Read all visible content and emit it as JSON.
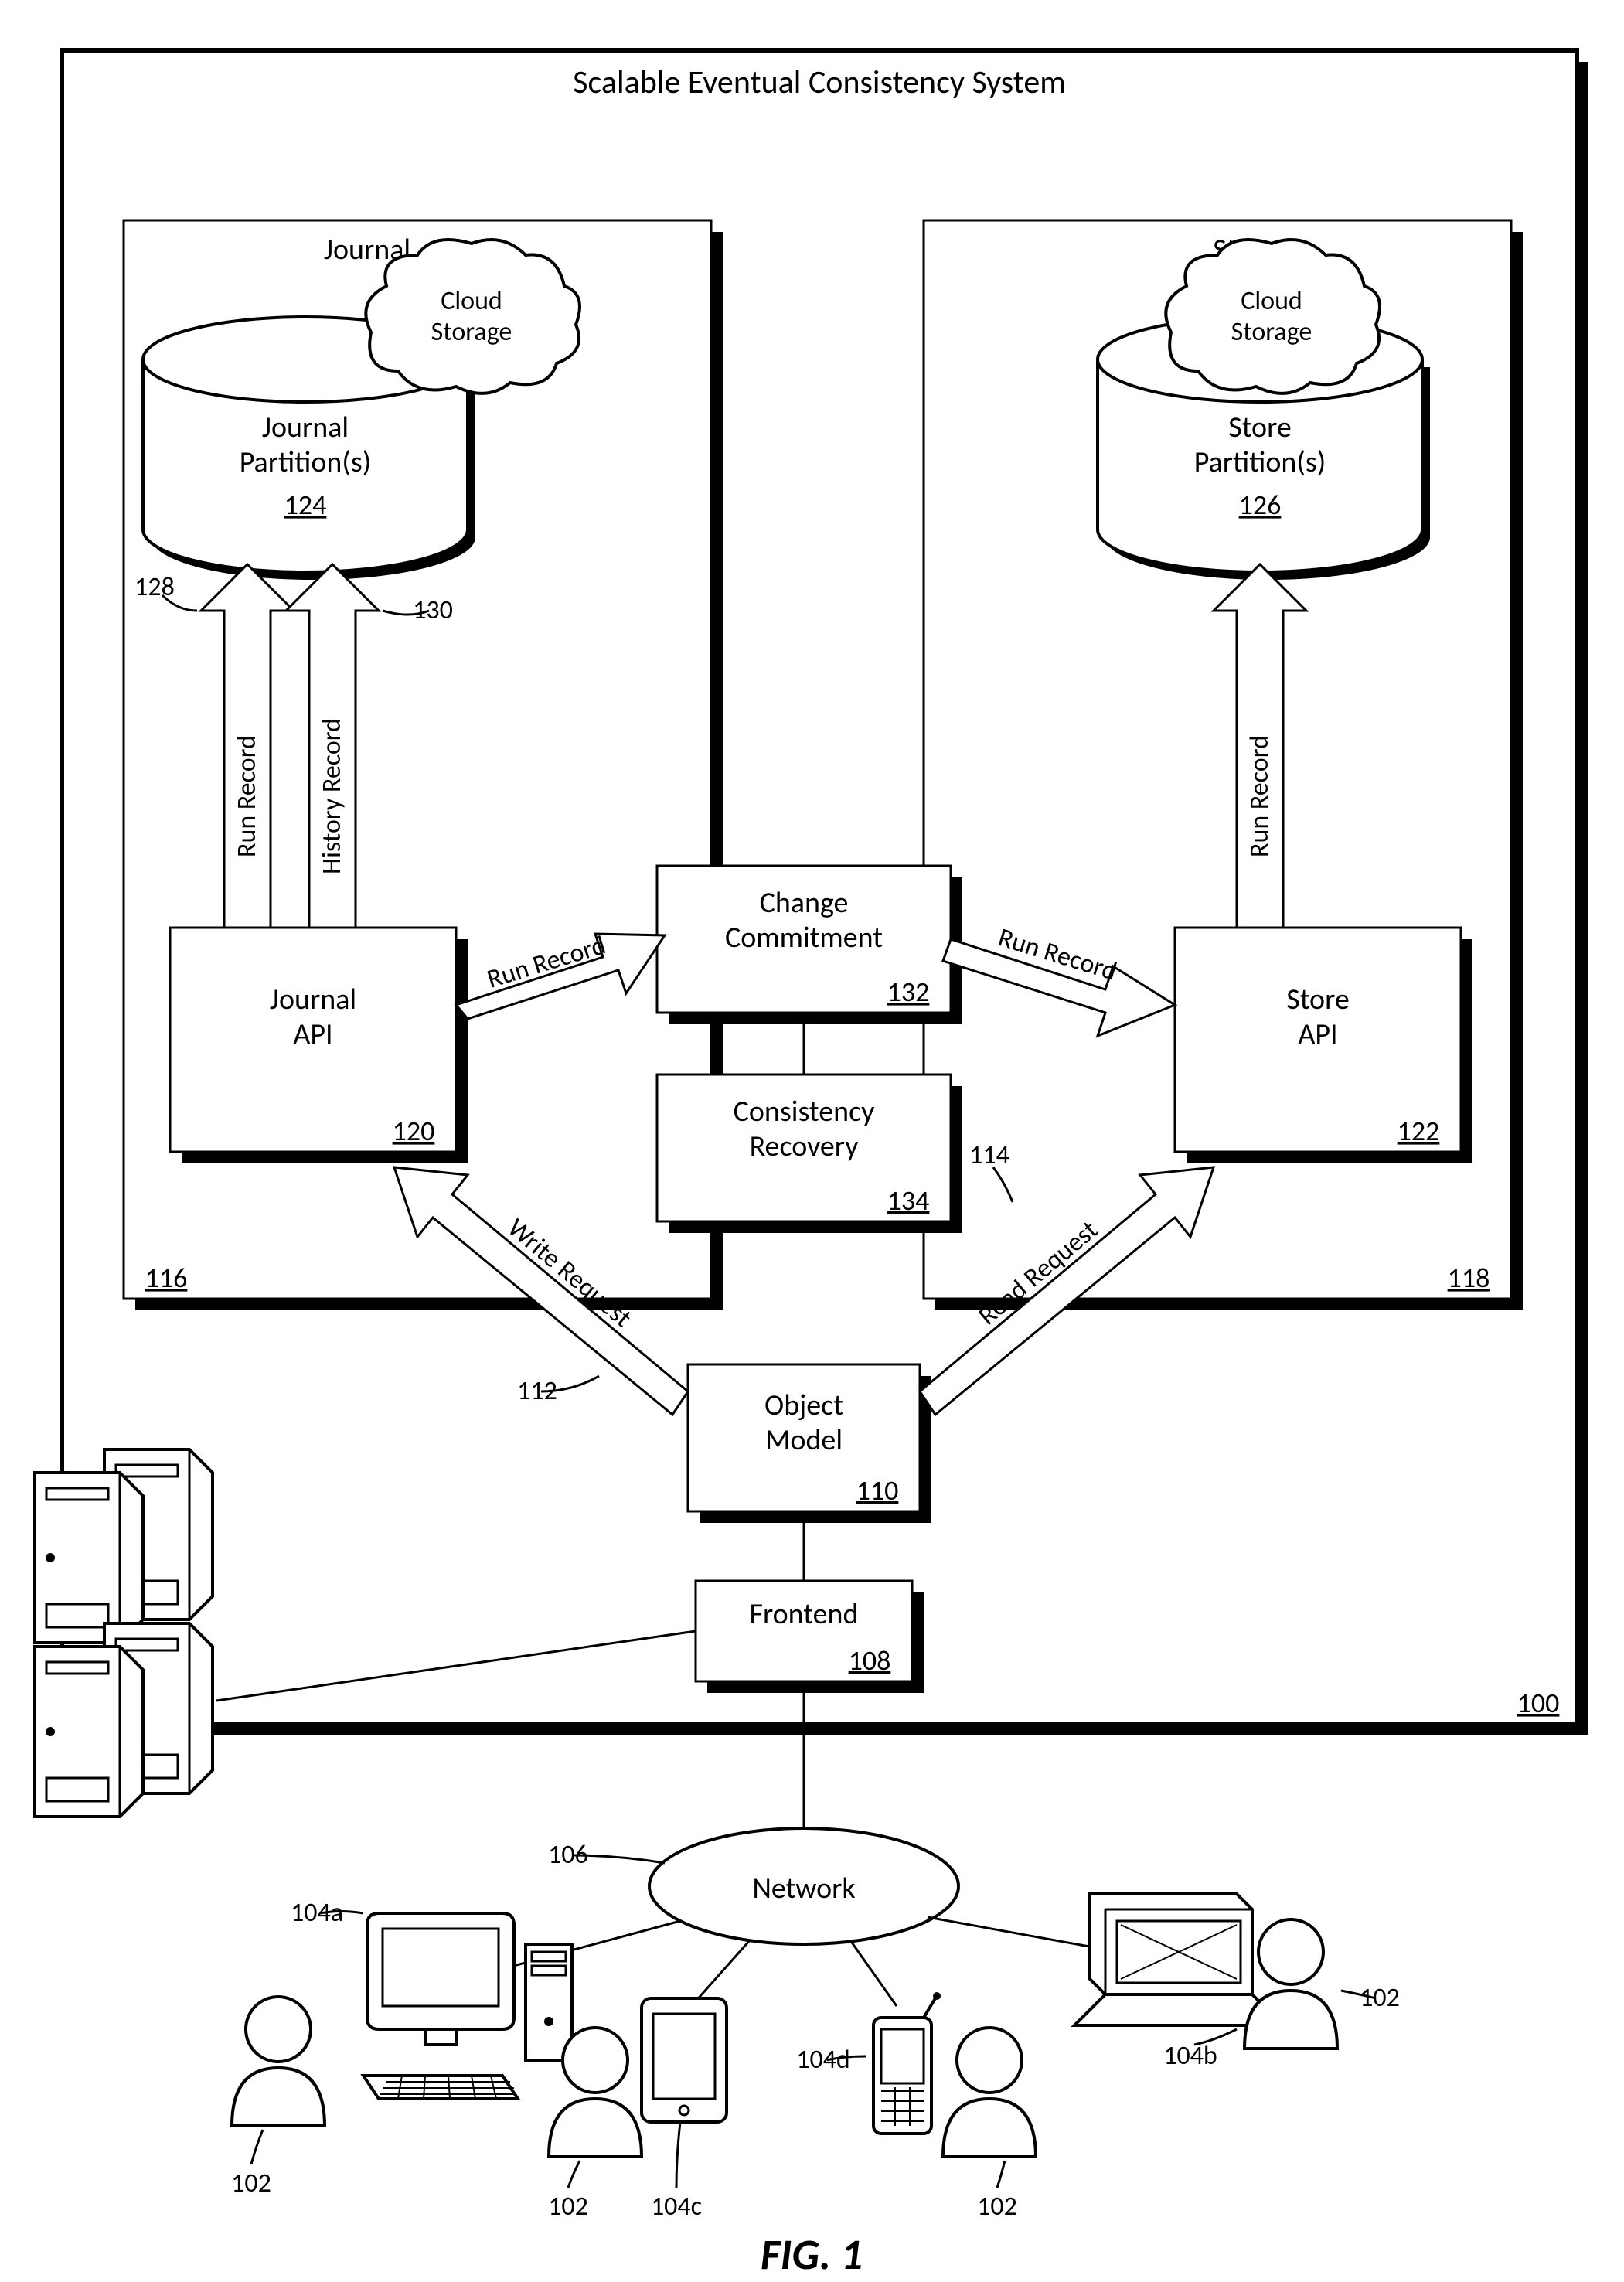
{
  "title": "Scalable Eventual Consistency System",
  "journal": {
    "heading": "Journal",
    "cloud": "Cloud Storage",
    "partitions": "Journal Partition(s)",
    "partitions_ref": "124",
    "api": "Journal API",
    "api_ref": "120",
    "box_ref": "116",
    "arrow_left": "Run Record",
    "arrow_right": "History Record",
    "ref_128": "128",
    "ref_130": "130"
  },
  "store": {
    "heading": "Store",
    "cloud": "Cloud Storage",
    "partitions": "Store Partition(s)",
    "partitions_ref": "126",
    "api": "Store API",
    "api_ref": "122",
    "box_ref": "118",
    "arrow": "Run Record"
  },
  "center": {
    "change_commitment": "Change Commitment",
    "change_commitment_ref": "132",
    "consistency_recovery": "Consistency Recovery",
    "consistency_recovery_ref": "134",
    "run_record_left": "Run Record",
    "run_record_right": "Run Record"
  },
  "object_model": {
    "label": "Object Model",
    "ref": "110",
    "write": "Write Request",
    "read": "Read Request",
    "ref_112": "112",
    "ref_114": "114"
  },
  "frontend": {
    "label": "Frontend",
    "ref": "108"
  },
  "system_ref": "100",
  "network": {
    "label": "Network",
    "ref_106": "106",
    "ref_104a": "104a",
    "ref_104b": "104b",
    "ref_104c": "104c",
    "ref_104d": "104d",
    "ref_102": "102"
  },
  "fig": "FIG. 1"
}
